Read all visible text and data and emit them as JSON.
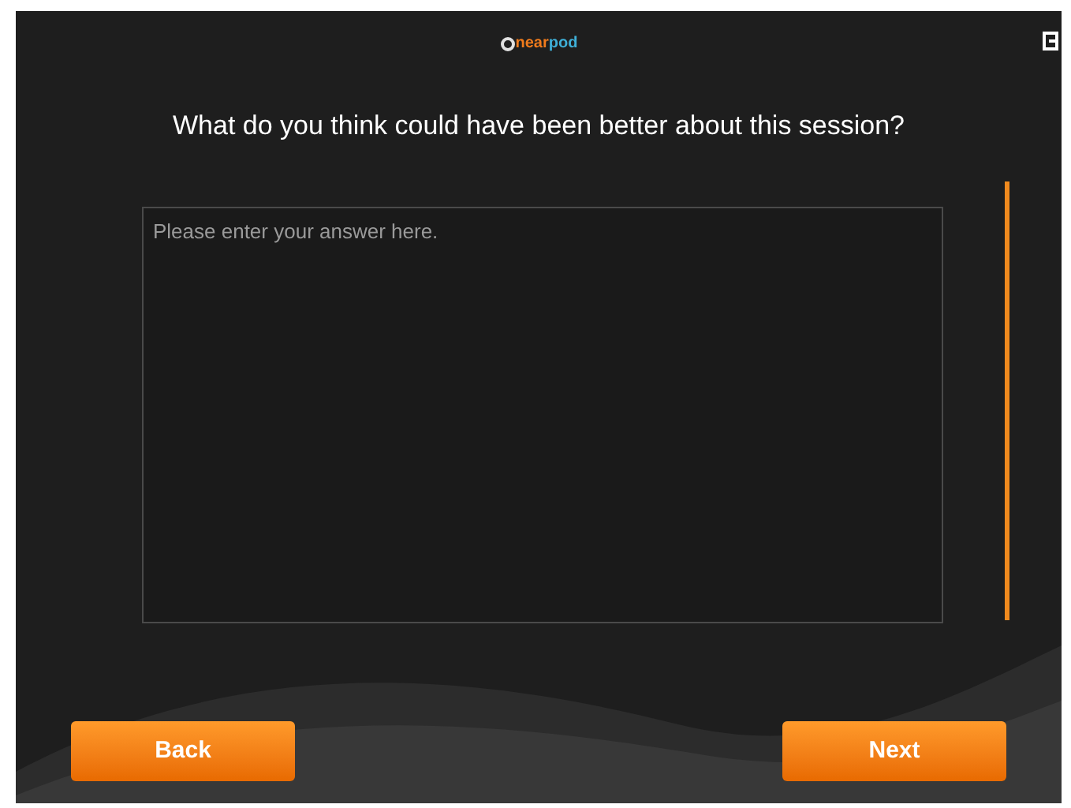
{
  "logo": {
    "text_1": "near",
    "text_2": "pod"
  },
  "question": "What do you think could have been better about this session?",
  "answer": {
    "placeholder": "Please enter your answer here."
  },
  "buttons": [
    {
      "label": "Back"
    },
    {
      "label": "Next"
    }
  ]
}
